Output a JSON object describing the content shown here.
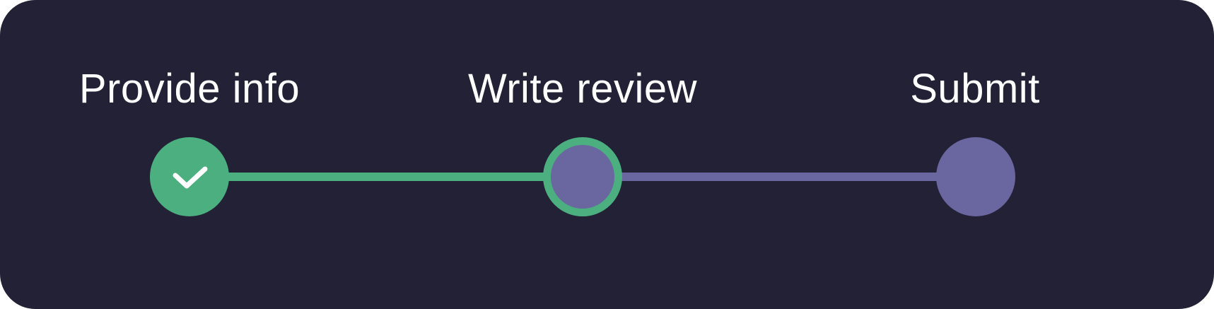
{
  "stepper": {
    "steps": [
      {
        "label": "Provide info",
        "state": "completed",
        "icon": "check-icon"
      },
      {
        "label": "Write review",
        "state": "current"
      },
      {
        "label": "Submit",
        "state": "upcoming"
      }
    ],
    "colors": {
      "background": "#222135",
      "completed": "#4caf7f",
      "upcoming": "#6966a0",
      "text": "#ffffff"
    }
  }
}
